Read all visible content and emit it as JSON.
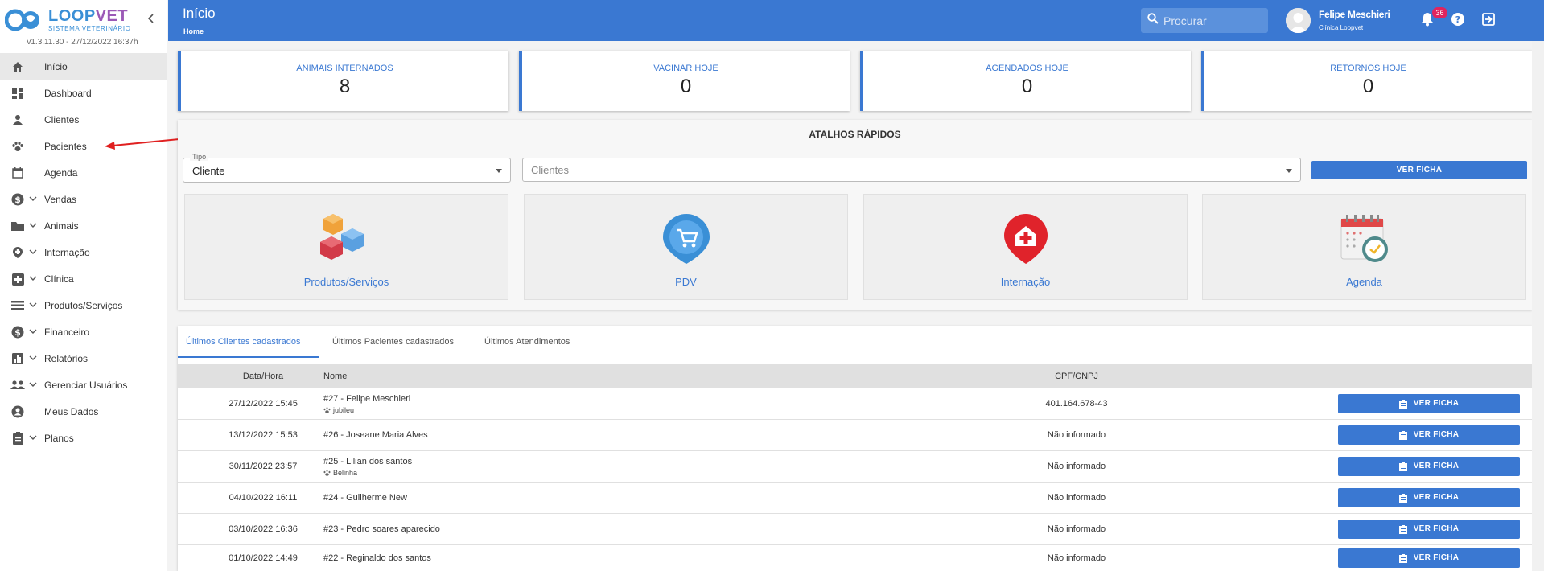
{
  "app": {
    "logo_part1": "LOOP",
    "logo_part2": "VET",
    "logo_sub": "SISTEMA VETERINÁRIO",
    "version": "v1.3.11.30 - 27/12/2022 16:37h"
  },
  "sidebar": {
    "items": [
      {
        "label": "Início",
        "icon": "home-icon"
      },
      {
        "label": "Dashboard",
        "icon": "dashboard-icon"
      },
      {
        "label": "Clientes",
        "icon": "person-icon"
      },
      {
        "label": "Pacientes",
        "icon": "paw-icon"
      },
      {
        "label": "Agenda",
        "icon": "calendar-icon"
      },
      {
        "label": "Vendas",
        "icon": "dollar-icon"
      },
      {
        "label": "Animais",
        "icon": "folder-icon"
      },
      {
        "label": "Internação",
        "icon": "hospital-pin-icon"
      },
      {
        "label": "Clínica",
        "icon": "medical-icon"
      },
      {
        "label": "Produtos/Serviços",
        "icon": "list-icon"
      },
      {
        "label": "Financeiro",
        "icon": "dollar-icon"
      },
      {
        "label": "Relatórios",
        "icon": "bar-chart-icon"
      },
      {
        "label": "Gerenciar Usuários",
        "icon": "group-icon"
      },
      {
        "label": "Meus Dados",
        "icon": "account-icon"
      },
      {
        "label": "Planos",
        "icon": "clipboard-icon"
      }
    ]
  },
  "header": {
    "title": "Início",
    "breadcrumb": "Home",
    "search_placeholder": "Procurar",
    "user_name": "Felipe Meschieri",
    "user_clinic": "Clínica Loopvet",
    "notifications": "36"
  },
  "stats": [
    {
      "title": "ANIMAIS INTERNADOS",
      "value": "8"
    },
    {
      "title": "VACINAR HOJE",
      "value": "0"
    },
    {
      "title": "AGENDADOS HOJE",
      "value": "0"
    },
    {
      "title": "RETORNOS HOJE",
      "value": "0"
    }
  ],
  "quick": {
    "title": "ATALHOS RÁPIDOS",
    "tipo_label": "Tipo",
    "tipo_value": "Cliente",
    "clientes_placeholder": "Clientes",
    "ver_ficha": "VER FICHA",
    "shortcuts": [
      {
        "label": "Produtos/Serviços",
        "icon": "cubes-icon"
      },
      {
        "label": "PDV",
        "icon": "cart-pin-icon"
      },
      {
        "label": "Internação",
        "icon": "hospital-pin-icon"
      },
      {
        "label": "Agenda",
        "icon": "calendar-clock-icon"
      }
    ]
  },
  "tabs": [
    "Últimos Clientes cadastrados",
    "Últimos Pacientes cadastrados",
    "Últimos Atendimentos"
  ],
  "table": {
    "headers": [
      "Data/Hora",
      "Nome",
      "CPF/CNPJ"
    ],
    "button_label": "VER FICHA",
    "rows": [
      {
        "date": "27/12/2022 15:45",
        "name": "#27 - Felipe Meschieri",
        "pet": "jubileu",
        "cpf": "401.164.678-43"
      },
      {
        "date": "13/12/2022 15:53",
        "name": "#26 - Joseane Maria Alves",
        "pet": "",
        "cpf": "Não informado"
      },
      {
        "date": "30/11/2022 23:57",
        "name": "#25 - Lilian dos santos",
        "pet": "Belinha",
        "cpf": "Não informado"
      },
      {
        "date": "04/10/2022 16:11",
        "name": "#24 - Guilherme New",
        "pet": "",
        "cpf": "Não informado"
      },
      {
        "date": "03/10/2022 16:36",
        "name": "#23 - Pedro soares aparecido",
        "pet": "",
        "cpf": "Não informado"
      },
      {
        "date": "01/10/2022 14:49",
        "name": "#22 - Reginaldo dos santos",
        "pet": "",
        "cpf": "Não informado"
      }
    ]
  },
  "colors": {
    "primary": "#3a78d2",
    "badge": "#e0245e",
    "annotation_arrow": "#e02020"
  }
}
